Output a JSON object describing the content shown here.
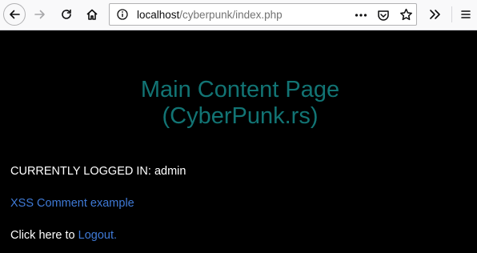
{
  "browser": {
    "url_host": "localhost",
    "url_path": "/cyberpunk/index.php",
    "icons": [
      "back-icon",
      "forward-icon",
      "reload-icon",
      "home-icon",
      "info-icon",
      "more-icon",
      "pocket-icon",
      "bookmark-star-icon",
      "overflow-icon",
      "menu-icon"
    ]
  },
  "page": {
    "title_line1": "Main Content Page",
    "title_line2": "(CyberPunk.rs)",
    "logged_in_text": "CURRENTLY LOGGED IN: admin",
    "xss_link": "XSS Comment example",
    "logout_prefix": "Click here to",
    "logout_link": "Logout."
  },
  "colors": {
    "background": "#000000",
    "heading": "#127474",
    "link": "#3f7ad6",
    "text": "#ffffff"
  }
}
